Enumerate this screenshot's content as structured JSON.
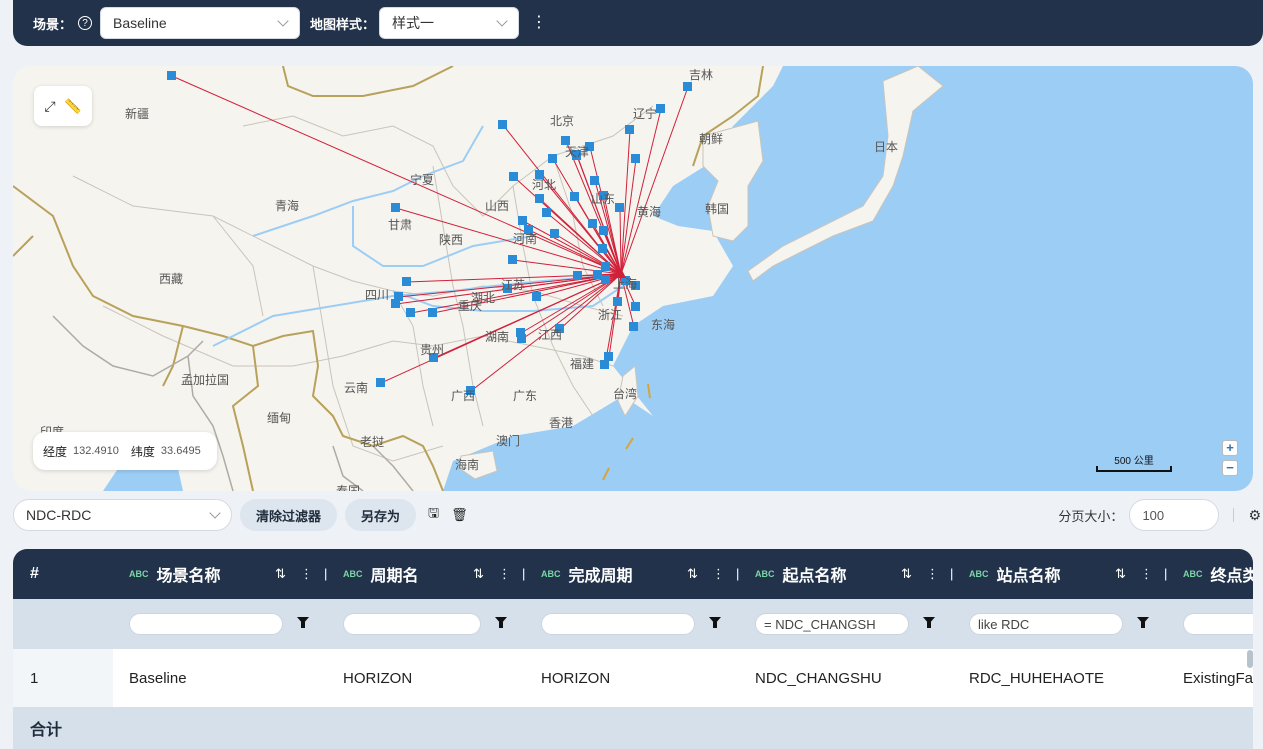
{
  "topbar": {
    "scene_label": "场景：",
    "help_icon": "?",
    "scene_value": "Baseline",
    "map_style_label": "地图样式：",
    "map_style_value": "样式一",
    "more_icon": "⋮"
  },
  "map": {
    "coords_lon_label": "经度",
    "coords_lon": "132.4910",
    "coords_lat_label": "纬度",
    "coords_lat": "33.6495",
    "scale_label": "500 公里",
    "zoom_in": "+",
    "zoom_out": "−",
    "labels": [
      "新疆",
      "吉林",
      "北京",
      "辽宁",
      "朝鲜",
      "日本",
      "天津",
      "宁夏",
      "青海",
      "甘肃",
      "山西",
      "河北",
      "山东",
      "黄海",
      "韩国",
      "陕西",
      "河南",
      "西藏",
      "四川",
      "江苏",
      "上海",
      "湖北",
      "重庆",
      "浙江",
      "东海",
      "贵州",
      "湖南",
      "江西",
      "福建",
      "云南",
      "广西",
      "广东",
      "台湾",
      "孟加拉国",
      "缅甸",
      "老挝",
      "香港",
      "澳门",
      "海南",
      "印度",
      "泰国"
    ]
  },
  "filter": {
    "view_value": "NDC-RDC",
    "clear_button": "清除过滤器",
    "save_as_button": "另存为",
    "page_size_label": "分页大小：",
    "page_size_value": "100"
  },
  "table": {
    "index_header": "#",
    "columns": [
      {
        "type": "ABC",
        "label": "场景名称",
        "filter": ""
      },
      {
        "type": "ABC",
        "label": "周期名",
        "filter": ""
      },
      {
        "type": "ABC",
        "label": "完成周期",
        "filter": ""
      },
      {
        "type": "ABC",
        "label": "起点名称",
        "filter": "= NDC_CHANGSH"
      },
      {
        "type": "ABC",
        "label": "站点名称",
        "filter": "like RDC"
      },
      {
        "type": "ABC",
        "label": "终点类",
        "filter": ""
      }
    ],
    "rows": [
      {
        "index": "1",
        "cells": [
          "Baseline",
          "HORIZON",
          "HORIZON",
          "NDC_CHANGSHU",
          "RDC_HUHEHAOTE",
          "ExistingFa"
        ]
      }
    ],
    "total_label": "合计"
  },
  "colors": {
    "header_bg": "#21324a",
    "route_line": "#d0213a",
    "site_marker": "#2a8bd6",
    "sea": "#9ccdf5",
    "land": "#f6f4ef"
  }
}
